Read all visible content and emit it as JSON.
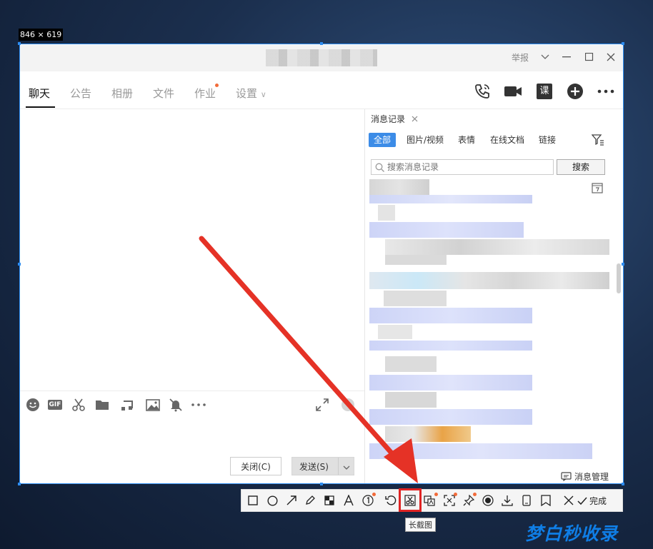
{
  "selection": {
    "size_label": "846 × 619"
  },
  "window": {
    "report": "举报",
    "tabs": [
      "聊天",
      "公告",
      "相册",
      "文件",
      "作业",
      "设置"
    ],
    "settings_caret": "∨"
  },
  "chat": {
    "close_label": "关闭(C)",
    "send_label": "发送(S)"
  },
  "history": {
    "tab_label": "消息记录",
    "filters": [
      "全部",
      "图片/视频",
      "表情",
      "在线文档",
      "链接"
    ],
    "search_placeholder": "搜索消息记录",
    "search_button": "搜索",
    "manage_label": "消息管理"
  },
  "snip": {
    "done_label": "完成",
    "tooltip": "长截图"
  },
  "watermark": "梦白秒收录",
  "colors": {
    "accent": "#3c8ce7",
    "highlight": "#e02424",
    "dot": "#f26b3a",
    "watermark": "#0f7ee6"
  }
}
